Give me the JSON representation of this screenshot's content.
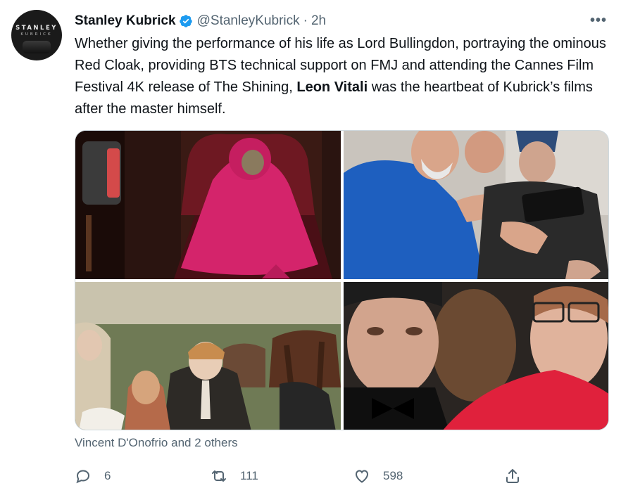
{
  "author": {
    "name": "Stanley Kubrick",
    "handle": "@StanleyKubrick",
    "separator": "·",
    "time": "2h",
    "avatar_line1": "STANLEY",
    "avatar_line2": "KUBRICK"
  },
  "tweet": {
    "text_before": "Whether giving the performance of his life as Lord Bullingdon, portraying the ominous Red Cloak, providing BTS technical support on FMJ and attending the Cannes Film Festival 4K release of The Shining, ",
    "text_bold": "Leon Vitali",
    "text_after": " was the heartbeat of Kubrick’s films after the master himself."
  },
  "more_label": "•••",
  "liked_by": "Vincent D'Onofrio and 2 others",
  "actions": {
    "replies": "6",
    "retweets": "111",
    "likes": "598"
  },
  "colors": {
    "verified": "#1d9bf0",
    "secondary_text": "#536471",
    "cloak": "#d4246b",
    "jacket": "#1e5fbf"
  },
  "icons": [
    "verified-badge-icon",
    "more-icon",
    "reply-icon",
    "retweet-icon",
    "like-icon",
    "share-icon"
  ]
}
